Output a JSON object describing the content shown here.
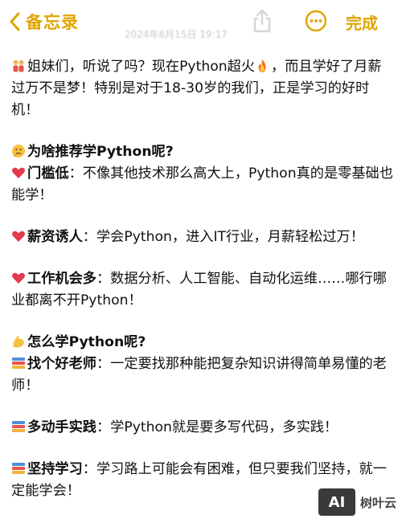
{
  "nav": {
    "back_label": "备忘录",
    "done_label": "完成",
    "date_text": "2024年6月15日 19:17",
    "back_icon": "chevron-left-icon",
    "share_icon": "share-icon",
    "more_icon": "ellipsis-circle-icon",
    "accent_color": "#e0a400"
  },
  "note": {
    "intro_a": "姐妹们，听说了吗？现在Python超火",
    "intro_b": "，而且学好了月薪过万不是梦！特别是对于18-30岁的我们，正是学习的好时机！",
    "section1_title": "为啥推荐学Python呢?",
    "item1_title": "门槛低",
    "item1_text": "：不像其他技术那么高大上，Python真的是零基础也能学！",
    "item2_title": "薪资诱人",
    "item2_text": "：学会Python，进入IT行业，月薪轻松过万！",
    "item3_title": "工作机会多",
    "item3_text": "：数据分析、人工智能、自动化运维……哪行哪业都离不开Python！",
    "section2_title": "怎么学Python呢?",
    "item4_title": "找个好老师",
    "item4_text": "：一定要找那种能把复杂知识讲得简单易懂的老师！",
    "item5_title": "多动手实践",
    "item5_text": "：学Python就是要多写代码，多实践！",
    "item6_title": "坚持学习",
    "item6_text": "：学习路上可能会有困难，但只要我们坚持，就一定能学会！"
  },
  "watermark": {
    "logo_text": "AI",
    "brand": "树叶云"
  }
}
